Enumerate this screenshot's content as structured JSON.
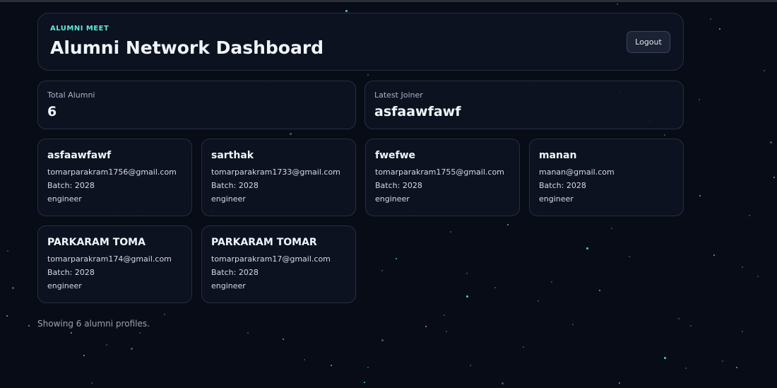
{
  "header": {
    "eyebrow": "ALUMNI MEET",
    "title": "Alumni Network Dashboard",
    "logout_label": "Logout"
  },
  "stats": {
    "total_label": "Total Alumni",
    "total_value": "6",
    "latest_label": "Latest Joiner",
    "latest_value": "asfaawfawf"
  },
  "alumni": [
    {
      "name": "asfaawfawf",
      "email": "tomarparakram1756@gmail.com",
      "batch": "Batch: 2028",
      "role": "engineer"
    },
    {
      "name": "sarthak",
      "email": "tomarparakram1733@gmail.com",
      "batch": "Batch: 2028",
      "role": "engineer"
    },
    {
      "name": "fwefwe",
      "email": "tomarparakram1755@gmail.com",
      "batch": "Batch: 2028",
      "role": "engineer"
    },
    {
      "name": "manan",
      "email": "manan@gmail.com",
      "batch": "Batch: 2028",
      "role": "engineer"
    },
    {
      "name": "PARKARAM TOMA",
      "email": "tomarparakram174@gmail.com",
      "batch": "Batch: 2028",
      "role": "engineer"
    },
    {
      "name": "PARKARAM TOMAR",
      "email": "tomarparakram17@gmail.com",
      "batch": "Batch: 2028",
      "role": "engineer"
    }
  ],
  "footer": {
    "text": "Showing 6 alumni profiles."
  },
  "colors": {
    "accent": "#5eead4",
    "background": "#080c16",
    "card": "#0d1422",
    "border": "#243044"
  }
}
